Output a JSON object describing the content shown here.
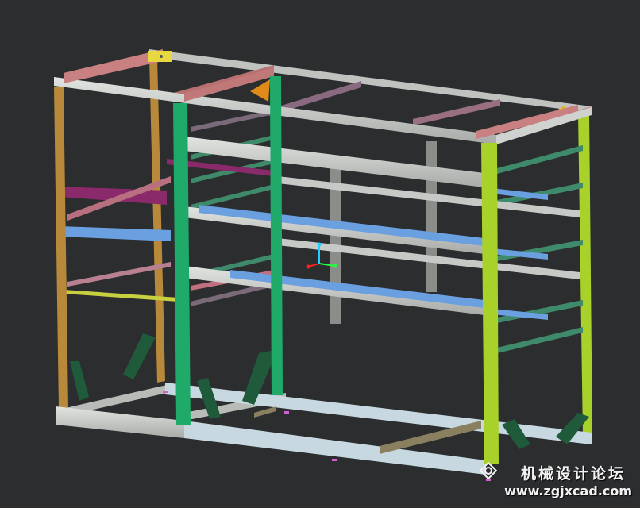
{
  "viewport": {
    "background": "#2b2d2f",
    "model": "steel shelving rack frame assembly"
  },
  "colors": {
    "frame_gray": "#c9ccc9",
    "top_rail_pink": "#c98080",
    "post_orange": "#b8893a",
    "post_green": "#1faa6a",
    "post_lime": "#a8d12a",
    "arm_teal": "#3e8a6a",
    "bar_blue": "#6a9fe0",
    "bar_magenta": "#8a2a6a",
    "brace_dark_green": "#1f5a3a",
    "base_light": "#c8d8e0",
    "gusset_orange": "#e08a1a",
    "axis_x": "#ff2020",
    "axis_y": "#20ff40",
    "axis_z": "#20d0ff"
  },
  "axis_triad": {
    "icon": "coordinate-triad-icon"
  },
  "watermark": {
    "logo_icon": "diamond-gear-logo-icon",
    "text_cn": "机械设计论坛",
    "url": "www.zgjxcad.com"
  }
}
